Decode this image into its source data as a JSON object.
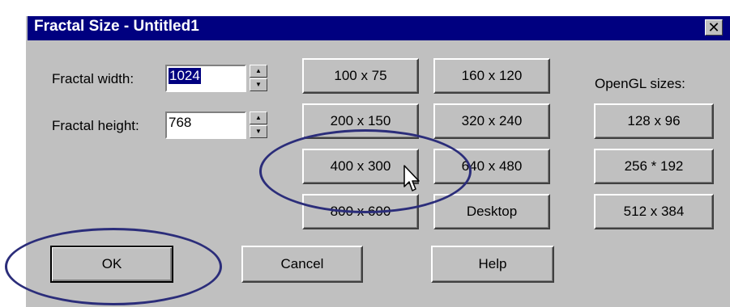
{
  "window": {
    "title": "Fractal Size - Untitled1",
    "close_symbol": "✕"
  },
  "fields": {
    "width_label": "Fractal width:",
    "width_value": "1024",
    "height_label": "Fractal height:",
    "height_value": "768"
  },
  "sizes": {
    "b100": "100 x 75",
    "b160": "160 x 120",
    "b200": "200 x 150",
    "b320": "320 x 240",
    "b400": "400 x 300",
    "b640": "640 x 480",
    "b800": "800 x 600",
    "desktop": "Desktop"
  },
  "opengl": {
    "label": "OpenGL sizes:",
    "b128": "128 x 96",
    "b256": "256 * 192",
    "b512": "512 x 384"
  },
  "actions": {
    "ok": "OK",
    "cancel": "Cancel",
    "help": "Help"
  },
  "spinner_up_symbol": "▲",
  "spinner_down_symbol": "▼",
  "annotation_color": "#2b2d7a"
}
